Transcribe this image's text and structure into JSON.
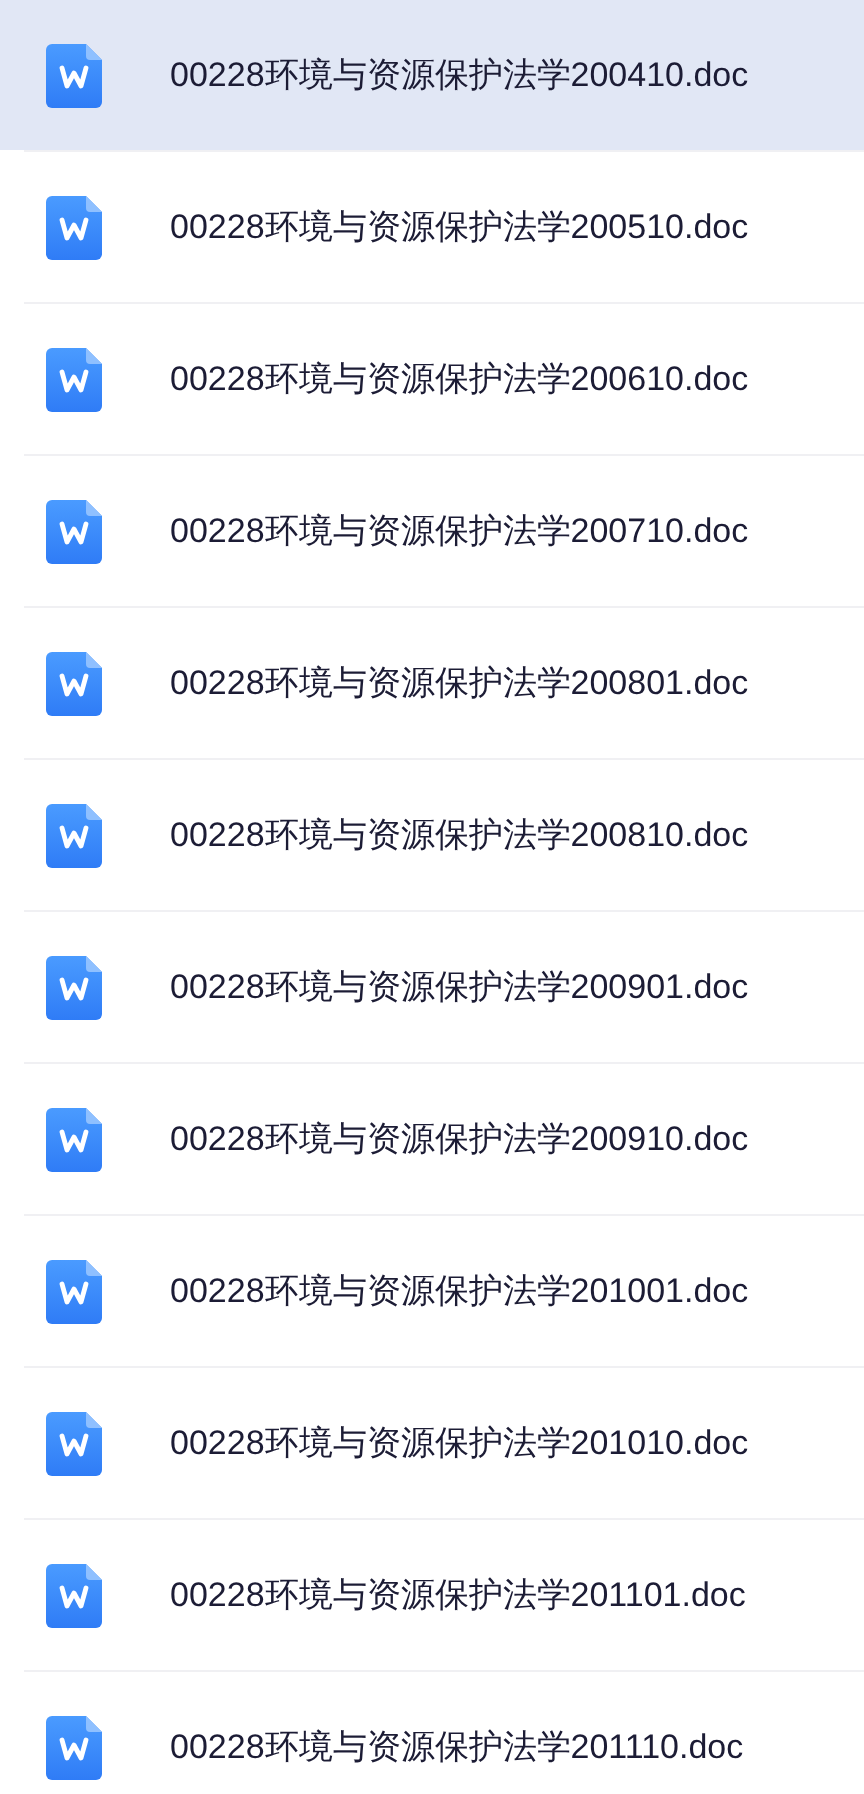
{
  "files": [
    {
      "name": "00228环境与资源保护法学200410.doc",
      "selected": true
    },
    {
      "name": "00228环境与资源保护法学200510.doc",
      "selected": false
    },
    {
      "name": "00228环境与资源保护法学200610.doc",
      "selected": false
    },
    {
      "name": "00228环境与资源保护法学200710.doc",
      "selected": false
    },
    {
      "name": "00228环境与资源保护法学200801.doc",
      "selected": false
    },
    {
      "name": "00228环境与资源保护法学200810.doc",
      "selected": false
    },
    {
      "name": "00228环境与资源保护法学200901.doc",
      "selected": false
    },
    {
      "name": "00228环境与资源保护法学200910.doc",
      "selected": false
    },
    {
      "name": "00228环境与资源保护法学201001.doc",
      "selected": false
    },
    {
      "name": "00228环境与资源保护法学201010.doc",
      "selected": false
    },
    {
      "name": "00228环境与资源保护法学201101.doc",
      "selected": false
    },
    {
      "name": "00228环境与资源保护法学201110.doc",
      "selected": false
    }
  ]
}
